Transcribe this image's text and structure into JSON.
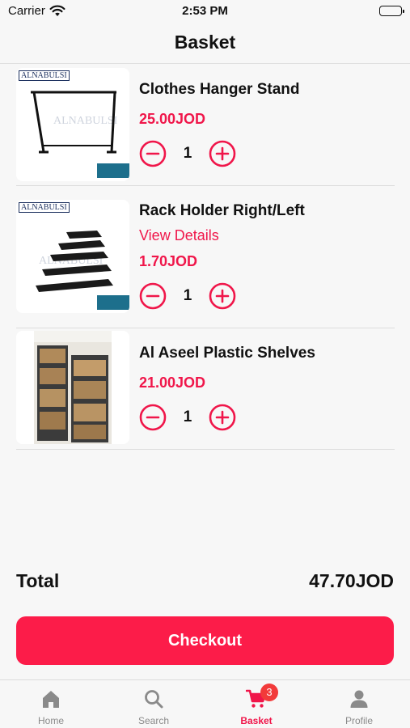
{
  "status_bar": {
    "carrier": "Carrier",
    "time": "2:53 PM"
  },
  "header": {
    "title": "Basket"
  },
  "items": [
    {
      "name": "Clothes Hanger Stand",
      "price": "25.00JOD",
      "quantity": "1",
      "logo": "ALNABULSI"
    },
    {
      "name": "Rack Holder Right/Left",
      "link": "View Details",
      "price": "1.70JOD",
      "quantity": "1",
      "logo": "ALNABULSI"
    },
    {
      "name": "Al Aseel Plastic Shelves",
      "price": "21.00JOD",
      "quantity": "1"
    }
  ],
  "summary": {
    "total_label": "Total",
    "total_value": "47.70JOD"
  },
  "checkout_label": "Checkout",
  "tabbar": {
    "tabs": [
      {
        "label": "Home",
        "icon": "home-icon"
      },
      {
        "label": "Search",
        "icon": "search-icon"
      },
      {
        "label": "Basket",
        "icon": "cart-icon",
        "badge": "3",
        "active": true
      },
      {
        "label": "Profile",
        "icon": "profile-icon"
      }
    ]
  },
  "colors": {
    "accent": "#f0164a",
    "checkout": "#fc1c49",
    "badge": "#f23a3a",
    "text": "#111111",
    "inactive_tab": "#8a8a8a"
  }
}
